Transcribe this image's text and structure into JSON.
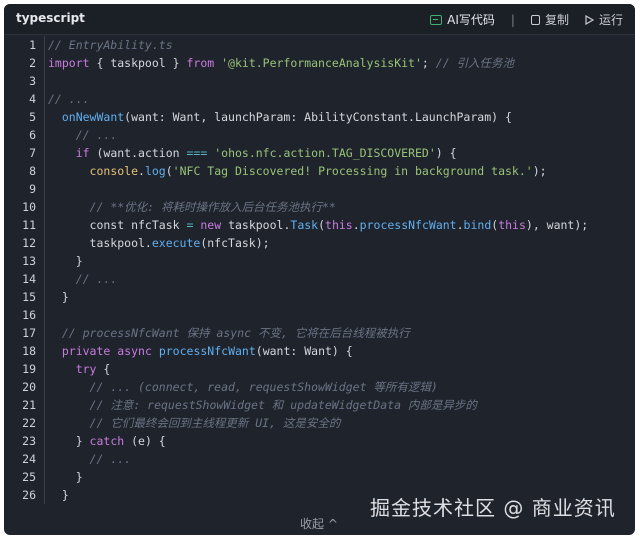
{
  "header": {
    "language": "typescript",
    "ai_label": "AI写代码",
    "copy_label": "复制",
    "run_label": "运行"
  },
  "footer": {
    "collapse_label": "收起 ^"
  },
  "watermark": "掘金技术社区 @ 商业资讯",
  "lines": [
    {
      "n": "1",
      "tokens": [
        [
          "c",
          "// EntryAbility.ts"
        ]
      ]
    },
    {
      "n": "2",
      "tokens": [
        [
          "k",
          "import"
        ],
        [
          "p",
          " { taskpool } "
        ],
        [
          "k",
          "from"
        ],
        [
          "p",
          " "
        ],
        [
          "s",
          "'@kit.PerformanceAnalysisKit'"
        ],
        [
          "p",
          "; "
        ],
        [
          "c",
          "// 引入任务池"
        ]
      ]
    },
    {
      "n": "3",
      "tokens": []
    },
    {
      "n": "4",
      "tokens": [
        [
          "c",
          "// ..."
        ]
      ]
    },
    {
      "n": "5",
      "tokens": [
        [
          "p",
          "  "
        ],
        [
          "f",
          "onNewWant"
        ],
        [
          "p",
          "(want: Want, launchParam: AbilityConstant.LaunchParam) {"
        ]
      ]
    },
    {
      "n": "6",
      "tokens": [
        [
          "p",
          "    "
        ],
        [
          "c",
          "// ..."
        ]
      ]
    },
    {
      "n": "7",
      "tokens": [
        [
          "p",
          "    "
        ],
        [
          "k",
          "if"
        ],
        [
          "p",
          " (want.action "
        ],
        [
          "g",
          "==="
        ],
        [
          "p",
          " "
        ],
        [
          "s",
          "'ohos.nfc.action.TAG_DISCOVERED'"
        ],
        [
          "p",
          ") {"
        ]
      ]
    },
    {
      "n": "8",
      "tokens": [
        [
          "p",
          "      "
        ],
        [
          "t",
          "console"
        ],
        [
          "p",
          "."
        ],
        [
          "f",
          "log"
        ],
        [
          "p",
          "("
        ],
        [
          "s",
          "'NFC Tag Discovered! Processing in background task.'"
        ],
        [
          "p",
          ");"
        ]
      ]
    },
    {
      "n": "9",
      "tokens": []
    },
    {
      "n": "10",
      "tokens": [
        [
          "p",
          "      "
        ],
        [
          "c",
          "// **优化: 将耗时操作放入后台任务池执行**"
        ]
      ]
    },
    {
      "n": "11",
      "tokens": [
        [
          "p",
          "      const nfcTask "
        ],
        [
          "g",
          "="
        ],
        [
          "p",
          " "
        ],
        [
          "k",
          "new"
        ],
        [
          "p",
          " taskpool."
        ],
        [
          "f",
          "Task"
        ],
        [
          "p",
          "("
        ],
        [
          "k",
          "this"
        ],
        [
          "p",
          "."
        ],
        [
          "f",
          "processNfcWant"
        ],
        [
          "p",
          "."
        ],
        [
          "f",
          "bind"
        ],
        [
          "p",
          "("
        ],
        [
          "k",
          "this"
        ],
        [
          "p",
          "), want);"
        ]
      ]
    },
    {
      "n": "12",
      "tokens": [
        [
          "p",
          "      taskpool."
        ],
        [
          "f",
          "execute"
        ],
        [
          "p",
          "(nfcTask);"
        ]
      ]
    },
    {
      "n": "13",
      "tokens": [
        [
          "p",
          "    }"
        ]
      ]
    },
    {
      "n": "14",
      "tokens": [
        [
          "p",
          "    "
        ],
        [
          "c",
          "// ..."
        ]
      ]
    },
    {
      "n": "15",
      "tokens": [
        [
          "p",
          "  }"
        ]
      ]
    },
    {
      "n": "16",
      "tokens": []
    },
    {
      "n": "17",
      "tokens": [
        [
          "p",
          "  "
        ],
        [
          "c",
          "// processNfcWant 保持 async 不变, 它将在后台线程被执行"
        ]
      ]
    },
    {
      "n": "18",
      "tokens": [
        [
          "p",
          "  "
        ],
        [
          "k",
          "private"
        ],
        [
          "p",
          " "
        ],
        [
          "k",
          "async"
        ],
        [
          "p",
          " "
        ],
        [
          "f",
          "processNfcWant"
        ],
        [
          "p",
          "(want: Want) {"
        ]
      ]
    },
    {
      "n": "19",
      "tokens": [
        [
          "p",
          "    "
        ],
        [
          "k",
          "try"
        ],
        [
          "p",
          " {"
        ]
      ]
    },
    {
      "n": "20",
      "tokens": [
        [
          "p",
          "      "
        ],
        [
          "c",
          "// ... (connect, read, requestShowWidget 等所有逻辑)"
        ]
      ]
    },
    {
      "n": "21",
      "tokens": [
        [
          "p",
          "      "
        ],
        [
          "c",
          "// 注意: requestShowWidget 和 updateWidgetData 内部是异步的"
        ]
      ]
    },
    {
      "n": "22",
      "tokens": [
        [
          "p",
          "      "
        ],
        [
          "c",
          "// 它们最终会回到主线程更新 UI, 这是安全的"
        ]
      ]
    },
    {
      "n": "23",
      "tokens": [
        [
          "p",
          "    } "
        ],
        [
          "k",
          "catch"
        ],
        [
          "p",
          " (e) {"
        ]
      ]
    },
    {
      "n": "24",
      "tokens": [
        [
          "p",
          "      "
        ],
        [
          "c",
          "// ..."
        ]
      ]
    },
    {
      "n": "25",
      "tokens": [
        [
          "p",
          "    }"
        ]
      ]
    },
    {
      "n": "26",
      "tokens": [
        [
          "p",
          "  }"
        ]
      ]
    }
  ]
}
